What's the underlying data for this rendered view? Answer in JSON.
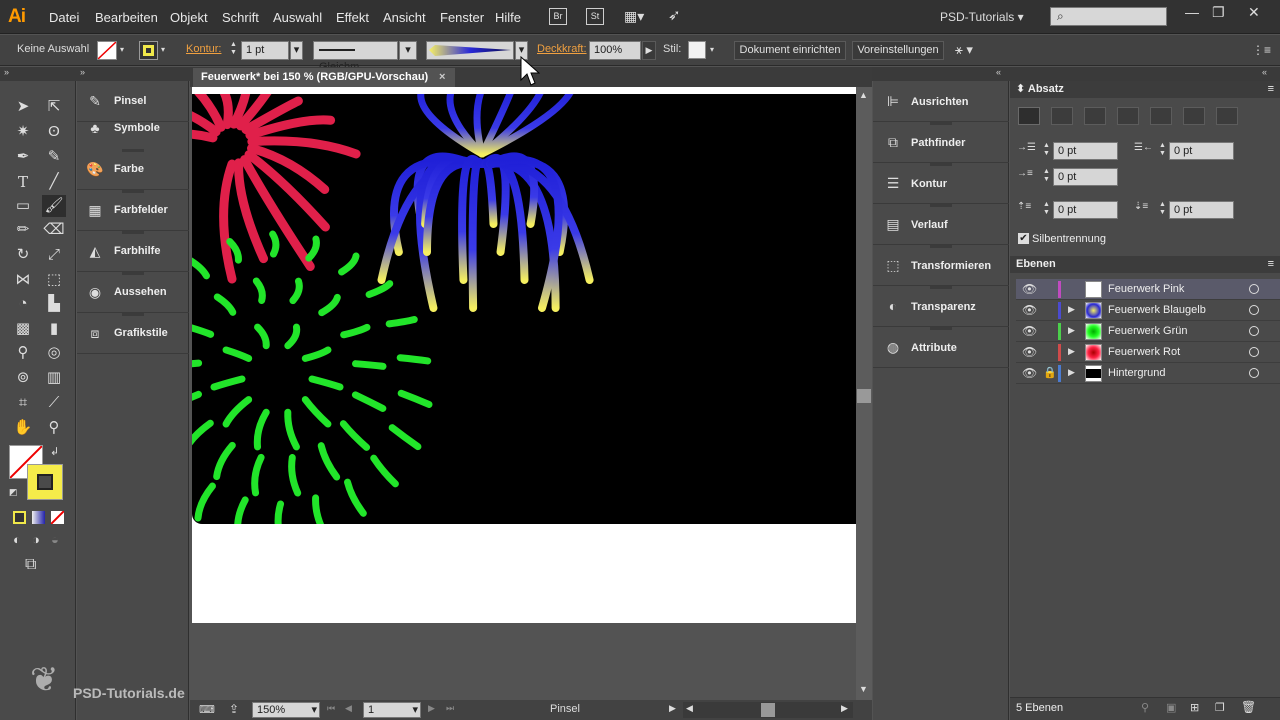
{
  "app": {
    "logo": "Ai"
  },
  "menu": [
    "Datei",
    "Bearbeiten",
    "Objekt",
    "Schrift",
    "Auswahl",
    "Effekt",
    "Ansicht",
    "Fenster",
    "Hilfe"
  ],
  "menu_buttons": [
    "Br",
    "St"
  ],
  "workspace": "PSD-Tutorials",
  "control_bar": {
    "selection": "Keine Auswahl",
    "kontur_label": "Kontur:",
    "kontur_value": "1 pt",
    "stroke_style": "Gleichm.",
    "opacity_label": "Deckkraft:",
    "opacity_value": "100%",
    "style_label": "Stil:",
    "doc_setup": "Dokument einrichten",
    "preferences": "Voreinstellungen"
  },
  "library_panel": [
    {
      "label": "Pinsel",
      "icon": "brush-icon"
    },
    {
      "label": "Symbole",
      "icon": "symbol-icon"
    },
    {
      "label": "Farbe",
      "icon": "palette-icon"
    },
    {
      "label": "Farbfelder",
      "icon": "swatches-icon"
    },
    {
      "label": "Farbhilfe",
      "icon": "color-guide-icon"
    },
    {
      "label": "Aussehen",
      "icon": "appearance-icon"
    },
    {
      "label": "Grafikstile",
      "icon": "graphic-styles-icon"
    }
  ],
  "document": {
    "tab_title": "Feuerwerk* bei 150 % (RGB/GPU-Vorschau)",
    "close": "×"
  },
  "status": {
    "zoom": "150%",
    "artboard": "1",
    "tool": "Pinsel"
  },
  "mid_panel": [
    {
      "label": "Ausrichten",
      "icon": "align-icon"
    },
    {
      "label": "Pathfinder",
      "icon": "pathfinder-icon"
    },
    {
      "label": "Kontur",
      "icon": "stroke-icon"
    },
    {
      "label": "Verlauf",
      "icon": "gradient-icon"
    },
    {
      "label": "Transformieren",
      "icon": "transform-icon"
    },
    {
      "label": "Transparenz",
      "icon": "transparency-icon"
    },
    {
      "label": "Attribute",
      "icon": "attributes-icon"
    }
  ],
  "paragraph_panel": {
    "title": "Absatz",
    "indent_left": "0 pt",
    "indent_right": "0 pt",
    "first_line": "0 pt",
    "space_before": "0 pt",
    "space_after": "0 pt",
    "hyphenation": "Silbentrennung"
  },
  "layers_panel": {
    "title": "Ebenen",
    "layers": [
      {
        "name": "Feuerwerk Pink",
        "color": "#c04bc0",
        "selected": true
      },
      {
        "name": "Feuerwerk Blaugelb",
        "color": "#4b4bd0",
        "selected": false
      },
      {
        "name": "Feuerwerk Grün",
        "color": "#4bd04b",
        "selected": false
      },
      {
        "name": "Feuerwerk Rot",
        "color": "#d04b4b",
        "selected": false
      },
      {
        "name": "Hintergrund",
        "color": "#4b7bd0",
        "selected": false
      }
    ],
    "footer": "5 Ebenen"
  },
  "watermark": "PSD-Tutorials.de"
}
